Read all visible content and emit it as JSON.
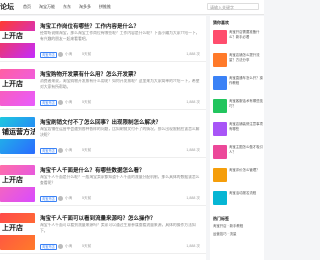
{
  "header": {
    "logo": "论坛",
    "nav": [
      "首页",
      "淘宝万能",
      "东东",
      "淘多多",
      "拼推推"
    ],
    "search_placeholder": "请输入关键字"
  },
  "articles": [
    {
      "thumb_text": "上开店",
      "thumb_colors": [
        "#ff3b30",
        "#c32cff"
      ],
      "title": "淘宝工作岗位有哪些？工作内容是什么？",
      "snippet": "经常听说做淘宝，那么淘宝工作岗位有哪些呢？工作内容是什么呢？下面小编为大家介绍一下，有兴趣的朋友一起来看看吧。",
      "tag": "淘宝开店",
      "author": "小淘",
      "time": "5天前",
      "reads": "1,888 次"
    },
    {
      "thumb_text": "上开店",
      "thumb_colors": [
        "#ff5fa2",
        "#e85bff"
      ],
      "title": "淘宝购物开发票有什么用？怎么开发票？",
      "snippet": "消费者来说，淘宝购物开发票有什么用呢？如何开发票呢？这里来为大家简单的介绍一下，希望对大家有所帮助。",
      "tag": "淘宝开店",
      "author": "小淘",
      "time": "5天前",
      "reads": "1,888 次"
    },
    {
      "thumb_text": "铺运营方法",
      "thumb_colors": [
        "#1ec8e0",
        "#2a6bff"
      ],
      "title": "淘宝刷销文付不了怎么回事？出现限制怎么解决？",
      "snippet": "淘宝店铺在运营中会遇到各种各样的问题，比如刷销文付不了的情况，那么出现限制应该怎么解决呢？",
      "tag": "淘宝开店",
      "author": "小淘",
      "time": "5天前",
      "reads": "1,888 次"
    },
    {
      "thumb_text": "上开店",
      "thumb_colors": [
        "#ff6fa8",
        "#d94bff"
      ],
      "title": "淘宝千人千面是什么？有哪些数据怎么看？",
      "snippet": "淘宝千人千面是什么呢？一般淘宝卖家都知道千人千面的流量分配机制，那么具体的数据该怎么查看呢？",
      "tag": "淘宝开店",
      "author": "小淘",
      "time": "5天前",
      "reads": "1,888 次"
    },
    {
      "thumb_text": "上开店",
      "thumb_colors": [
        "#ff4a4a",
        "#ff7a2a"
      ],
      "title": "淘宝千人千面可以看到流量来源吗？怎么操作？",
      "snippet": "淘宝千人千面可以看到流量来源吗？卖家可以通过生意参谋查看流量来源，具体的操作方法如下。",
      "tag": "淘宝开店",
      "author": "小淘",
      "time": "5天前",
      "reads": "1,888 次"
    }
  ],
  "sidebar": {
    "title": "猜你喜欢",
    "items": [
      {
        "text": "淘宝开店需要准备什么？新手必看",
        "color": "#ff4d6d"
      },
      {
        "text": "淘宝店铺怎么提升流量？方法分享",
        "color": "#ff7a2a"
      },
      {
        "text": "淘宝直通车怎么开？操作教程",
        "color": "#3b82f6"
      },
      {
        "text": "淘宝客服话术有哪些技巧？",
        "color": "#22c55e"
      },
      {
        "text": "淘宝店铺装修注意事项有哪些",
        "color": "#a855f7"
      },
      {
        "text": "淘宝主图怎么做才吸引人？",
        "color": "#ec4899"
      },
      {
        "text": "淘宝评价怎么管理？",
        "color": "#f59e0b"
      },
      {
        "text": "淘宝活动报名流程",
        "color": "#06b6d4"
      }
    ],
    "hot_title": "热门标签",
    "hot_items": [
      "淘宝开店 · 新手教程",
      "运营技巧 · 流量"
    ]
  }
}
